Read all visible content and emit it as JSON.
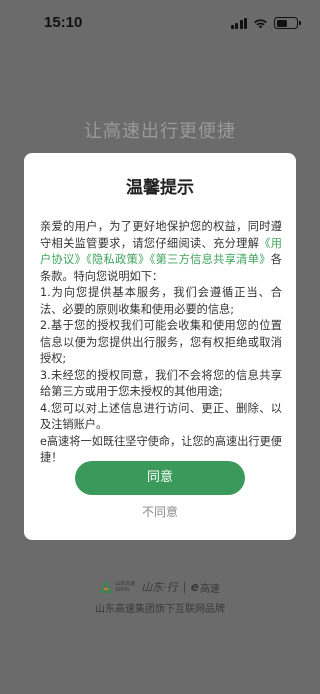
{
  "status_bar": {
    "time": "15:10"
  },
  "slogan": "让高速出行更便捷",
  "dialog": {
    "title": "温馨提示",
    "intro_1": "亲爱的用户，为了更好地保护您的权益，同时遵守相关监管要求，请您仔细阅读、充分理解",
    "link_user_agreement": "《用户协议》",
    "link_privacy": "《隐私政策》",
    "link_third_party": "《第三方信息共享清单》",
    "intro_2": "各条款。特向您说明如下：",
    "item_1": "1.为向您提供基本服务，我们会遵循正当、合法、必要的原则收集和使用必要的信息;",
    "item_2": "2.基于您的授权我们可能会收集和使用您的位置信息以便为您提供出行服务，您有权拒绝或取消授权;",
    "item_3": "3.未经您的授权同意，我们不会将您的信息共享给第三方或用于您未授权的其他用途;",
    "item_4": "4.您可以对上述信息进行访问、更正、删除、以及注销账户。",
    "closing": "e高速将一如既往坚守使命，让您的高速出行更便捷！",
    "agree_label": "同意",
    "disagree_label": "不同意"
  },
  "footer": {
    "logo_text_cn": "山东高速",
    "logo_text_en": "SDHS",
    "logo_hand": "山东·行",
    "ebrand_e": "e",
    "ebrand_text": "高速",
    "caption": "山东高速集团旗下互联网品牌"
  },
  "colors": {
    "accent_green": "#3b9a5b",
    "link_green": "#3fa35a",
    "overlay": "#6b6b6b"
  }
}
